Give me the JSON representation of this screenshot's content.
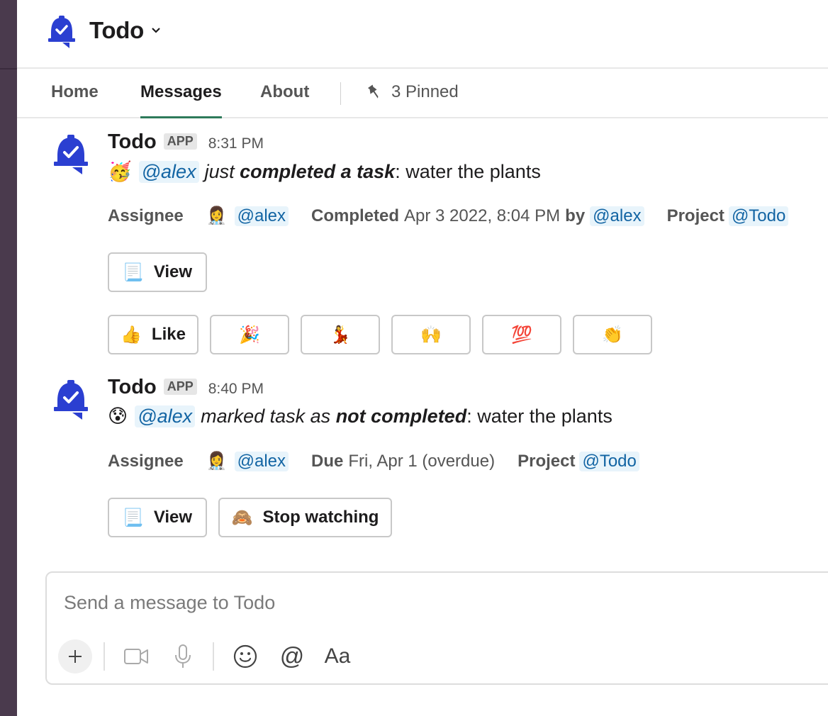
{
  "header": {
    "title": "Todo"
  },
  "tabs": [
    {
      "label": "Home"
    },
    {
      "label": "Messages",
      "active": true
    },
    {
      "label": "About"
    }
  ],
  "pinned": {
    "label": "3 Pinned"
  },
  "messages": [
    {
      "sender": "Todo",
      "badge": "APP",
      "time": "8:31 PM",
      "emoji": "🥳",
      "mention": "@alex",
      "pre_italic": "just ",
      "bold_italic": "completed a task",
      "rest": ": water the plants",
      "fields": {
        "assignee_label": "Assignee",
        "assignee_emoji": "👩‍⚕️",
        "assignee": "@alex",
        "completed_label": "Completed",
        "completed_value": "Apr 3 2022, 8:04 PM",
        "by_label": "by",
        "by": "@alex",
        "project_label": "Project",
        "project": "@Todo"
      },
      "view_button": {
        "icon": "📃",
        "label": "View"
      },
      "reactions": [
        {
          "emoji": "👍",
          "label": "Like"
        },
        {
          "emoji": "🎉",
          "label": ""
        },
        {
          "emoji": "💃",
          "label": ""
        },
        {
          "emoji": "🙌",
          "label": ""
        },
        {
          "emoji": "💯",
          "label": ""
        },
        {
          "emoji": "👏",
          "label": ""
        }
      ]
    },
    {
      "sender": "Todo",
      "badge": "APP",
      "time": "8:40 PM",
      "emoji": "😰",
      "mention": "@alex",
      "pre_italic": "marked task as ",
      "bold_italic": "not completed",
      "rest": ": water the plants",
      "fields": {
        "assignee_label": "Assignee",
        "assignee_emoji": "👩‍⚕️",
        "assignee": "@alex",
        "due_label": "Due",
        "due_value": "Fri, Apr 1 (overdue)",
        "project_label": "Project",
        "project": "@Todo"
      },
      "view_button": {
        "icon": "📃",
        "label": "View"
      },
      "stop_button": {
        "icon": "🙈",
        "label": "Stop watching"
      }
    }
  ],
  "composer": {
    "placeholder": "Send a message to Todo"
  },
  "colors": {
    "brand": "#2b3fd1",
    "tab_active": "#2e7a5a",
    "mention_bg": "#e8f4fb",
    "mention_fg": "#1264a3",
    "rail": "#4a3a4d"
  }
}
